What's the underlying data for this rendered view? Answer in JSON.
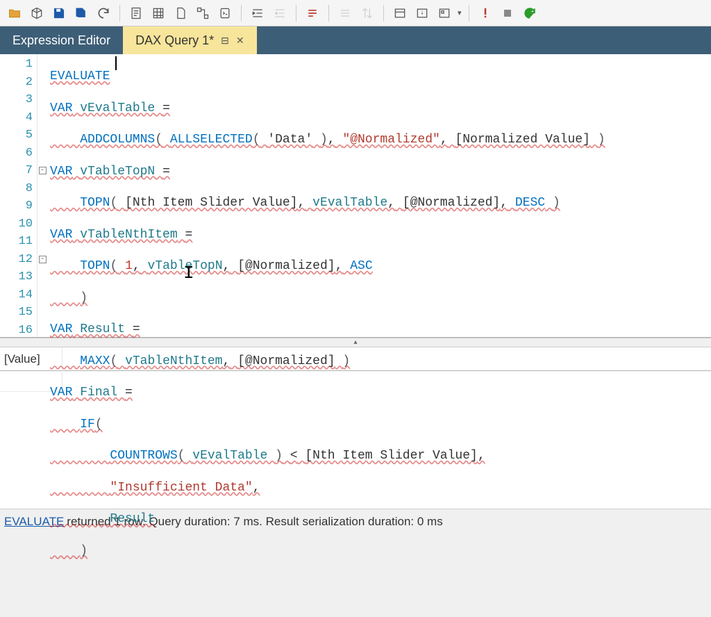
{
  "tabs": {
    "inactive": "Expression Editor",
    "active": "DAX Query 1*"
  },
  "gutter": [
    "1",
    "2",
    "3",
    "4",
    "5",
    "6",
    "7",
    "8",
    "9",
    "10",
    "11",
    "12",
    "13",
    "14",
    "15",
    "16"
  ],
  "code": {
    "l1": {
      "a": "EVALUATE"
    },
    "l2": {
      "a": "VAR",
      "b": "vEvalTable",
      "c": "="
    },
    "l3": {
      "a": "ADDCOLUMNS",
      "b": "(",
      "c": "ALLSELECTED",
      "d": "(",
      "e": "'Data'",
      "f": ")",
      "g": ",",
      "h": "\"@Normalized\"",
      "i": ",",
      "j": "[Normalized Value]",
      "k": ")"
    },
    "l4": {
      "a": "VAR",
      "b": "vTableTopN",
      "c": "="
    },
    "l5": {
      "a": "TOPN",
      "b": "(",
      "c": "[Nth Item Slider Value]",
      "d": ",",
      "e": "vEvalTable",
      "f": ",",
      "g": "[@Normalized]",
      "h": ",",
      "i": "DESC",
      "j": ")"
    },
    "l6": {
      "a": "VAR",
      "b": "vTableNthItem",
      "c": "="
    },
    "l7": {
      "a": "TOPN",
      "b": "(",
      "c": "1",
      "d": ",",
      "e": "vTableTopN",
      "f": ",",
      "g": "[@Normalized]",
      "h": ",",
      "i": "ASC"
    },
    "l8": {
      "a": ")"
    },
    "l9": {
      "a": "VAR",
      "b": "Result",
      "c": "="
    },
    "l10": {
      "a": "MAXX",
      "b": "(",
      "c": "vTableNthItem",
      "d": ",",
      "e": "[@Normalized]",
      "f": ")"
    },
    "l11": {
      "a": "VAR",
      "b": "Final",
      "c": "="
    },
    "l12": {
      "a": "IF",
      "b": "("
    },
    "l13": {
      "a": "COUNTROWS",
      "b": "(",
      "c": "vEvalTable",
      "d": ")",
      "e": "<",
      "f": "[Nth Item Slider Value]",
      "g": ","
    },
    "l14": {
      "a": "\"Insufficient Data\"",
      "b": ","
    },
    "l15": {
      "a": "Result"
    },
    "l16": {
      "a": ")"
    }
  },
  "results": {
    "header": "[Value]"
  },
  "status": {
    "link": "EVALUATE",
    "rest": " returned 1 row. Query duration: 7 ms. Result serialization duration: 0 ms"
  }
}
